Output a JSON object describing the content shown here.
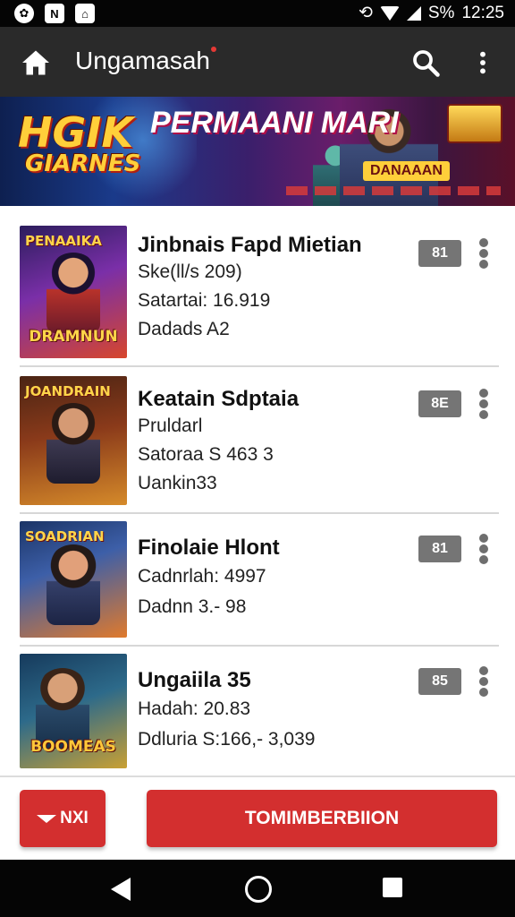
{
  "status_bar": {
    "icons_left": [
      "settings-gear-icon",
      "n-app-icon",
      "download-icon"
    ],
    "battery_text": "S%",
    "time": "12:25"
  },
  "app_bar": {
    "title": "Ungamasah",
    "icons": [
      "home-icon",
      "search-icon",
      "more-vert-icon"
    ]
  },
  "banner": {
    "logo_line1": "HGIK",
    "logo_line2": "GIARNES",
    "title": "PERMAANI MARI",
    "caption": "DANAAAN"
  },
  "games": [
    {
      "thumb_top": "PENAAIKA",
      "thumb_bottom": "DRAMNUN",
      "thumb_colors": [
        "#2b1d5c",
        "#d7462c"
      ],
      "title": "Jinbnais Fapd Mietian",
      "line1": "Ske(ll/s 209)",
      "line2": "Satartai: 16.919",
      "line3": "Dadads A2",
      "badge": "81"
    },
    {
      "thumb_top": "JOANDRAIN",
      "thumb_bottom": "",
      "thumb_colors": [
        "#4a2414",
        "#d58a2a"
      ],
      "title": "Keatain Sdptaia",
      "line1": "Pruldarl",
      "line2": "Satoraa S 463  3",
      "line3": "Uankin33",
      "badge": "8E"
    },
    {
      "thumb_top": "SOADRIAN",
      "thumb_bottom": "",
      "thumb_colors": [
        "#1b3466",
        "#e07a2c"
      ],
      "title": "Finolaie Hlont",
      "line1": "Cadnrlah: 4997",
      "line2": "Dadnn 3.- 98",
      "line3": "",
      "badge": "81"
    },
    {
      "thumb_top": "",
      "thumb_bottom": "BOOMEAS",
      "thumb_colors": [
        "#163a5c",
        "#c9a033"
      ],
      "title": "Ungaiila 35",
      "line1": "Hadah: 20.83",
      "line2": "Ddluria S:166,- 3,039",
      "line3": "",
      "badge": "85"
    }
  ],
  "actions": {
    "small_button": "NXI",
    "primary_button": "TOMIMBERBIION"
  },
  "nav_bar": {
    "icons": [
      "back-icon",
      "home-circle-icon",
      "recents-icon"
    ]
  }
}
